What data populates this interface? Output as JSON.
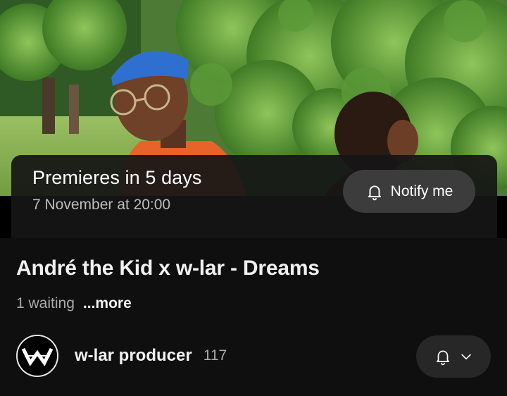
{
  "premiere": {
    "title": "Premieres in 5 days",
    "date": "7 November at 20:00",
    "notify_label": "Notify me"
  },
  "video": {
    "title": "André the Kid x w-lar - Dreams",
    "waiting": "1 waiting",
    "more_label": "...more"
  },
  "channel": {
    "name": "w-lar producer",
    "subscribers": "117",
    "avatar_letter": "W"
  },
  "colors": {
    "background": "#0f0f0f",
    "panel": "#161616",
    "button": "#3c3c3c",
    "secondary_text": "#aaaaaa"
  },
  "icons": [
    "bell-icon",
    "chevron-down-icon",
    "channel-logo"
  ]
}
